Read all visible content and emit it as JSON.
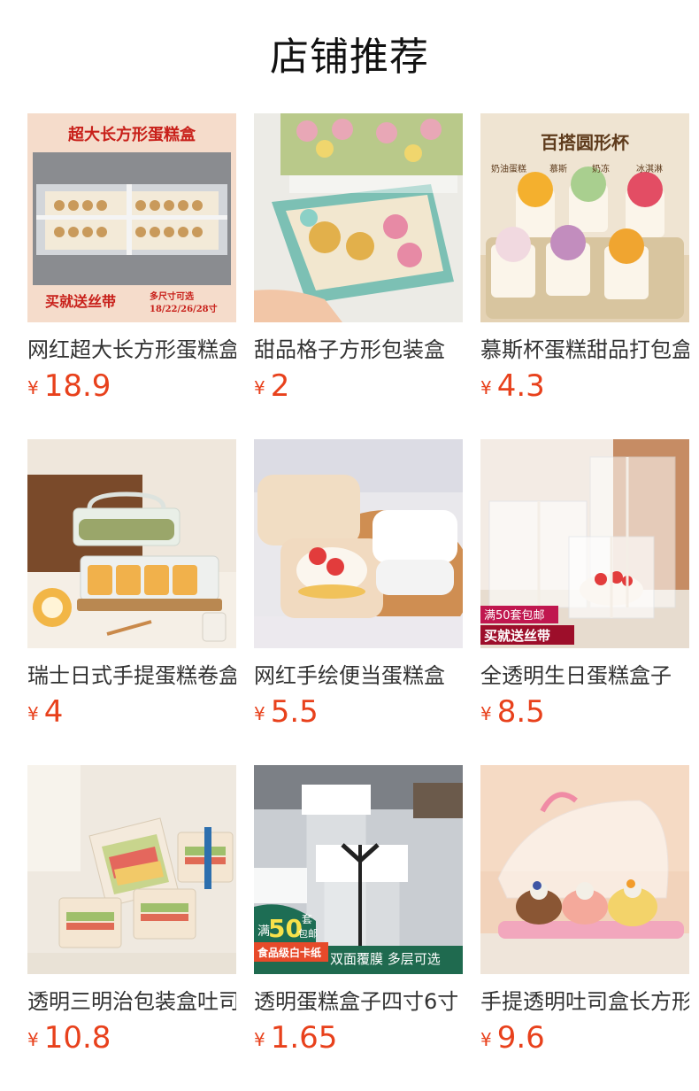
{
  "page": {
    "title": "店铺推荐"
  },
  "currency_symbol": "¥",
  "colors": {
    "price": "#e8411c",
    "text": "#333333"
  },
  "products": [
    {
      "name": "网红超大长方形蛋糕盒",
      "price": "18.9",
      "image": "large-rectangular-cake-box-image",
      "image_text": {
        "headline": "超大长方形蛋糕盒",
        "promo": "买就送丝带",
        "sizes_label": "多尺寸可选",
        "sizes": "18/22/26/28寸"
      }
    },
    {
      "name": "甜品格子方形包装盒",
      "price": "2",
      "image": "checkered-dessert-box-image"
    },
    {
      "name": "慕斯杯蛋糕甜品打包盒",
      "price": "4.3",
      "image": "mousse-cups-image",
      "image_text": {
        "headline": "百搭圆形杯",
        "tags": [
          "奶油蛋糕",
          "慕斯",
          "奶冻",
          "冰淇淋"
        ]
      }
    },
    {
      "name": "瑞士日式手提蛋糕卷盒",
      "price": "4",
      "image": "swiss-roll-handle-box-image"
    },
    {
      "name": "网红手绘便当蛋糕盒",
      "price": "5.5",
      "image": "bento-cake-box-image"
    },
    {
      "name": "全透明生日蛋糕盒子",
      "price": "8.5",
      "image": "transparent-birthday-cake-box-image",
      "image_text": {
        "promo_top": "满50套包邮",
        "promo_bottom": "买就送丝带"
      }
    },
    {
      "name": "透明三明治包装盒吐司",
      "price": "10.8",
      "image": "sandwich-boxes-image"
    },
    {
      "name": "透明蛋糕盒子四寸6寸",
      "price": "1.65",
      "image": "tall-transparent-cake-box-image",
      "image_text": {
        "badge_prefix": "满",
        "badge_number": "50",
        "badge_unit": "套",
        "badge_suffix": "包邮",
        "material": "食品级白卡纸",
        "features": "双面覆膜 多层可选"
      }
    },
    {
      "name": "手提透明吐司盒长方形",
      "price": "9.6",
      "image": "handle-toast-box-image"
    }
  ]
}
